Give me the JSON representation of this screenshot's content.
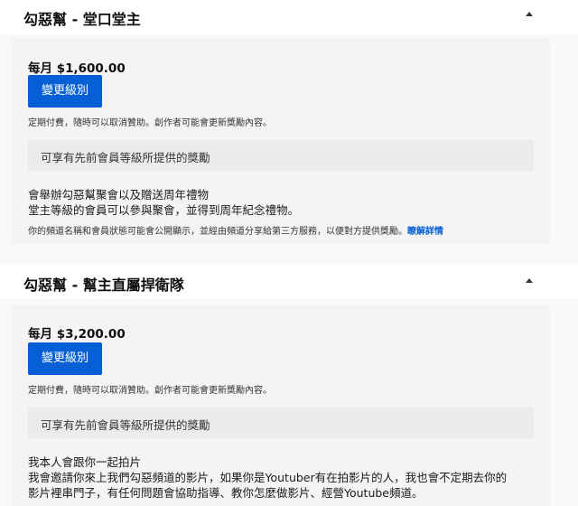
{
  "tiers": [
    {
      "title": "勾惡幫 - 堂口堂主",
      "price": "每月 $1,600.00",
      "button_label": "變更級別",
      "billing_note": "定期付費，隨時可以取消贊助。創作者可能會更新獎勵內容。",
      "previous_perks": "可享有先前會員等級所提供的獎勵",
      "perks": [
        "會舉辦勾惡幫聚會以及贈送周年禮物",
        "堂主等級的會員可以參與聚會，並得到周年紀念禮物。"
      ],
      "privacy_note": "你的頻道名稱和會員狀態可能會公開顯示，並經由頻道分享給第三方服務，以便對方提供獎勵。",
      "learn_more": "瞭解詳情"
    },
    {
      "title": "勾惡幫 - 幫主直屬捍衛隊",
      "price": "每月 $3,200.00",
      "button_label": "變更級別",
      "billing_note": "定期付費，隨時可以取消贊助。創作者可能會更新獎勵內容。",
      "previous_perks": "可享有先前會員等級所提供的獎勵",
      "perks": [
        "我本人會跟你一起拍片",
        "我會邀請你來上我們勾惡頻道的影片，如果你是Youtuber有在拍影片的人，我也會不定期去你的",
        "影片裡串門子，有任何問題會協助指導、教你怎麼做影片、經營Youtube頻道。"
      ]
    }
  ],
  "colors": {
    "accent": "#065fd4",
    "card_background": "#f4f4f4",
    "perk_box": "#ebebeb",
    "page_background": "#f9f9f9"
  },
  "icons": {
    "collapse": "caret-up-icon"
  }
}
